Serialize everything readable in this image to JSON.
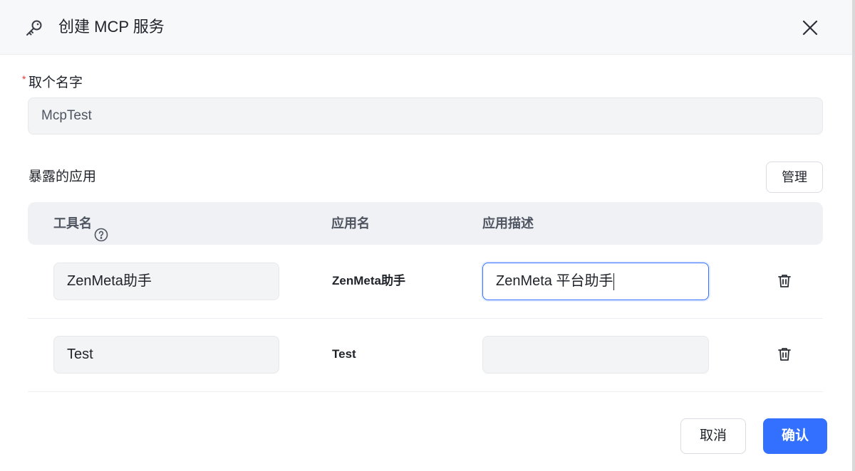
{
  "dialog": {
    "title": "创建 MCP 服务",
    "title_icon": "key-icon",
    "close_icon": "close-icon"
  },
  "name_field": {
    "required_mark": "*",
    "label": "取个名字",
    "value": "McpTest"
  },
  "exposed_apps": {
    "section_title": "暴露的应用",
    "manage_label": "管理",
    "columns": {
      "tool_name": "工具名",
      "tool_name_help_icon": "question-circle-icon",
      "app_name": "应用名",
      "app_description": "应用描述"
    },
    "rows": [
      {
        "tool_name": "ZenMeta助手",
        "app_name": "ZenMeta助手",
        "description": "ZenMeta 平台助手",
        "focused": true,
        "delete_icon": "trash-icon"
      },
      {
        "tool_name": "Test",
        "app_name": "Test",
        "description": "",
        "focused": false,
        "delete_icon": "trash-icon"
      }
    ]
  },
  "footer": {
    "cancel_label": "取消",
    "confirm_label": "确认",
    "confirm_color": "#3370ff"
  }
}
